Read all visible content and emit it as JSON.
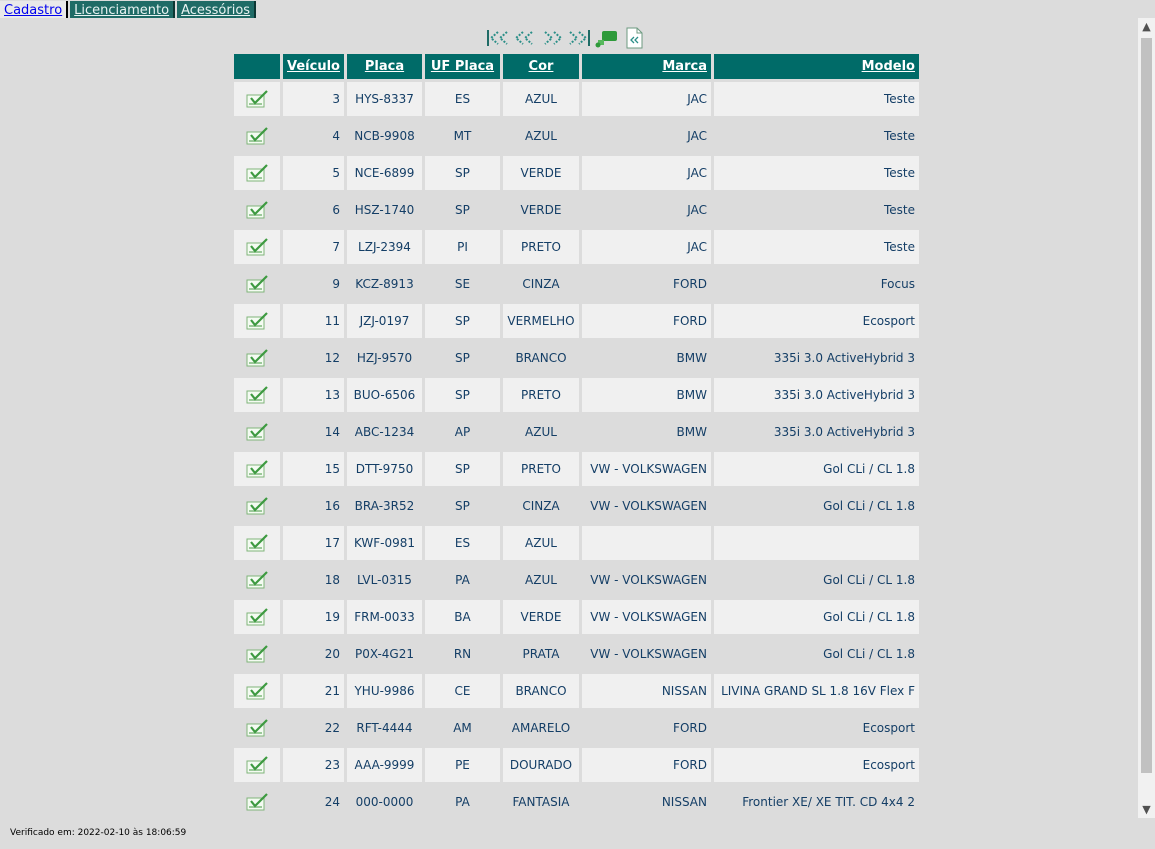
{
  "tabs": [
    "Cadastro",
    "Licenciamento",
    "Acessórios"
  ],
  "columns": {
    "veiculo": "Veículo",
    "placa": "Placa",
    "uf": "UF Placa",
    "cor": "Cor",
    "marca": "Marca",
    "modelo": "Modelo"
  },
  "rows": [
    {
      "veiculo": "3",
      "placa": "HYS-8337",
      "uf": "ES",
      "cor": "AZUL",
      "marca": "JAC",
      "modelo": "Teste"
    },
    {
      "veiculo": "4",
      "placa": "NCB-9908",
      "uf": "MT",
      "cor": "AZUL",
      "marca": "JAC",
      "modelo": "Teste"
    },
    {
      "veiculo": "5",
      "placa": "NCE-6899",
      "uf": "SP",
      "cor": "VERDE",
      "marca": "JAC",
      "modelo": "Teste"
    },
    {
      "veiculo": "6",
      "placa": "HSZ-1740",
      "uf": "SP",
      "cor": "VERDE",
      "marca": "JAC",
      "modelo": "Teste"
    },
    {
      "veiculo": "7",
      "placa": "LZJ-2394",
      "uf": "PI",
      "cor": "PRETO",
      "marca": "JAC",
      "modelo": "Teste"
    },
    {
      "veiculo": "9",
      "placa": "KCZ-8913",
      "uf": "SE",
      "cor": "CINZA",
      "marca": "FORD",
      "modelo": "Focus"
    },
    {
      "veiculo": "11",
      "placa": "JZJ-0197",
      "uf": "SP",
      "cor": "VERMELHO",
      "marca": "FORD",
      "modelo": "Ecosport"
    },
    {
      "veiculo": "12",
      "placa": "HZJ-9570",
      "uf": "SP",
      "cor": "BRANCO",
      "marca": "BMW",
      "modelo": "335i 3.0 ActiveHybrid 3"
    },
    {
      "veiculo": "13",
      "placa": "BUO-6506",
      "uf": "SP",
      "cor": "PRETO",
      "marca": "BMW",
      "modelo": "335i 3.0 ActiveHybrid 3"
    },
    {
      "veiculo": "14",
      "placa": "ABC-1234",
      "uf": "AP",
      "cor": "AZUL",
      "marca": "BMW",
      "modelo": "335i 3.0 ActiveHybrid 3"
    },
    {
      "veiculo": "15",
      "placa": "DTT-9750",
      "uf": "SP",
      "cor": "PRETO",
      "marca": "VW - VOLKSWAGEN",
      "modelo": "Gol CLi / CL 1.8"
    },
    {
      "veiculo": "16",
      "placa": "BRA-3R52",
      "uf": "SP",
      "cor": "CINZA",
      "marca": "VW - VOLKSWAGEN",
      "modelo": "Gol CLi / CL 1.8"
    },
    {
      "veiculo": "17",
      "placa": "KWF-0981",
      "uf": "ES",
      "cor": "AZUL",
      "marca": "",
      "modelo": ""
    },
    {
      "veiculo": "18",
      "placa": "LVL-0315",
      "uf": "PA",
      "cor": "AZUL",
      "marca": "VW - VOLKSWAGEN",
      "modelo": "Gol CLi / CL 1.8"
    },
    {
      "veiculo": "19",
      "placa": "FRM-0033",
      "uf": "BA",
      "cor": "VERDE",
      "marca": "VW - VOLKSWAGEN",
      "modelo": "Gol CLi / CL 1.8"
    },
    {
      "veiculo": "20",
      "placa": "P0X-4G21",
      "uf": "RN",
      "cor": "PRATA",
      "marca": "VW - VOLKSWAGEN",
      "modelo": "Gol CLi / CL 1.8"
    },
    {
      "veiculo": "21",
      "placa": "YHU-9986",
      "uf": "CE",
      "cor": "BRANCO",
      "marca": "NISSAN",
      "modelo": "LIVINA GRAND SL 1.8 16V Flex F"
    },
    {
      "veiculo": "22",
      "placa": "RFT-4444",
      "uf": "AM",
      "cor": "AMARELO",
      "marca": "FORD",
      "modelo": "Ecosport"
    },
    {
      "veiculo": "23",
      "placa": "AAA-9999",
      "uf": "PE",
      "cor": "DOURADO",
      "marca": "FORD",
      "modelo": "Ecosport"
    },
    {
      "veiculo": "24",
      "placa": "000-0000",
      "uf": "PA",
      "cor": "FANTASIA",
      "marca": "NISSAN",
      "modelo": "Frontier XE/ XE TIT. CD 4x4 2"
    }
  ],
  "footer": "Verificado em: 2022-02-10 às 18:06:59"
}
